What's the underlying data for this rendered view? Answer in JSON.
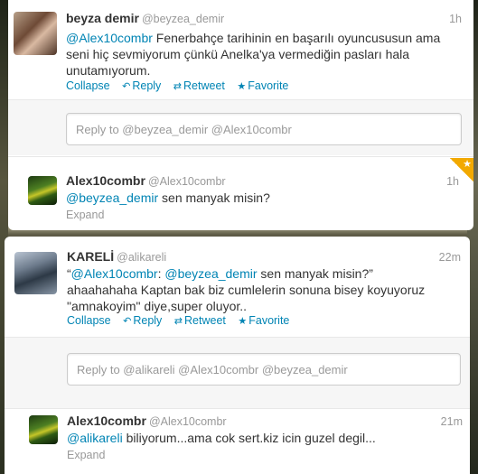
{
  "conversation1": {
    "tweet1": {
      "name": "beyza demir",
      "handle": "@beyzea_demir",
      "time": "1h",
      "mention": "@Alex10combr",
      "text_rest": " Fenerbahçe tarihinin en başarılı oyuncusu​sun ama seni hiç sevmiyorum çünkü Anelka'ya vermediğin pasları hala unutamıyorum.",
      "actions": {
        "collapse": "Collapse",
        "reply": "Reply",
        "retweet": "Retweet",
        "favorite": "Favorite"
      }
    },
    "reply_placeholder": "Reply to @beyzea_demir @Alex10combr",
    "tweet2": {
      "name": "Alex10combr",
      "handle": "@Alex10combr",
      "time": "1h",
      "mention": "@beyzea_demir",
      "text_rest": " sen manyak misin?",
      "expand": "Expand"
    }
  },
  "conversation2": {
    "tweet1": {
      "name": "KARELİ",
      "handle": "@alikareli",
      "time": "22m",
      "quote_open": "“",
      "mention1": "@Alex10combr",
      "sep": ": ",
      "mention2": "@beyzea_demir",
      "text_quote": " sen manyak misin?”",
      "text_rest": "ahaahahaha Kaptan bak biz cumlelerin sonuna bisey koyuyoruz \"amnakoyim\" diye,super oluyor..",
      "actions": {
        "collapse": "Collapse",
        "reply": "Reply",
        "retweet": "Retweet",
        "favorite": "Favorite"
      }
    },
    "reply_placeholder": "Reply to @alikareli @Alex10combr @beyzea_demir",
    "tweet2": {
      "name": "Alex10combr",
      "handle": "@Alex10combr",
      "time": "21m",
      "mention": "@alikareli",
      "text_rest": " biliyorum...ama cok sert.kiz icin guzel degil...",
      "expand": "Expand"
    }
  },
  "icons": [
    "reply-icon",
    "retweet-icon",
    "favorite-star-icon",
    "favorited-corner-icon"
  ],
  "colors": {
    "link": "#0084b4",
    "favorite_corner": "#f2a900",
    "muted": "#999999"
  }
}
